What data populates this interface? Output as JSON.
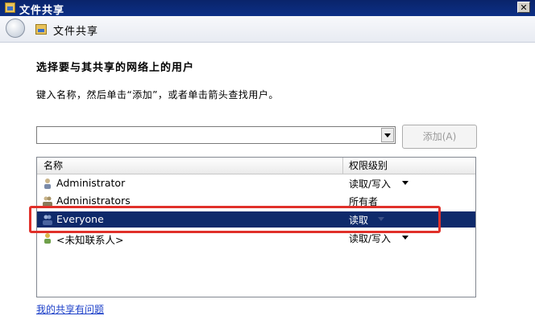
{
  "window": {
    "title": "文件共享",
    "close_glyph": "✕"
  },
  "nav": {
    "title": "文件共享"
  },
  "heading": "选择要与其共享的网络上的用户",
  "instruction": "键入名称，然后单击“添加”，或者单击箭头查找用户。",
  "user_input": {
    "value": "",
    "placeholder": ""
  },
  "add_button": {
    "label": "添加(A)"
  },
  "list": {
    "columns": {
      "name": "名称",
      "permission": "权限级别"
    },
    "rows": [
      {
        "name": "Administrator",
        "permission": "读取/写入",
        "icon": "user-icon",
        "has_dropdown": true
      },
      {
        "name": "Administrators",
        "permission": "所有者",
        "icon": "group-icon",
        "has_dropdown": false
      },
      {
        "name": "Everyone",
        "permission": "读取",
        "icon": "group-icon",
        "has_dropdown": true,
        "selected": true
      },
      {
        "name": "<未知联系人>",
        "permission": "读取/写入",
        "icon": "unknown-contact-icon",
        "has_dropdown": true
      }
    ]
  },
  "help_link": "我的共享有问题",
  "colors": {
    "titlebar": "#0a246a",
    "selection": "#0f2a6b",
    "highlight_box": "#e0302a",
    "link": "#1a3ec8"
  }
}
